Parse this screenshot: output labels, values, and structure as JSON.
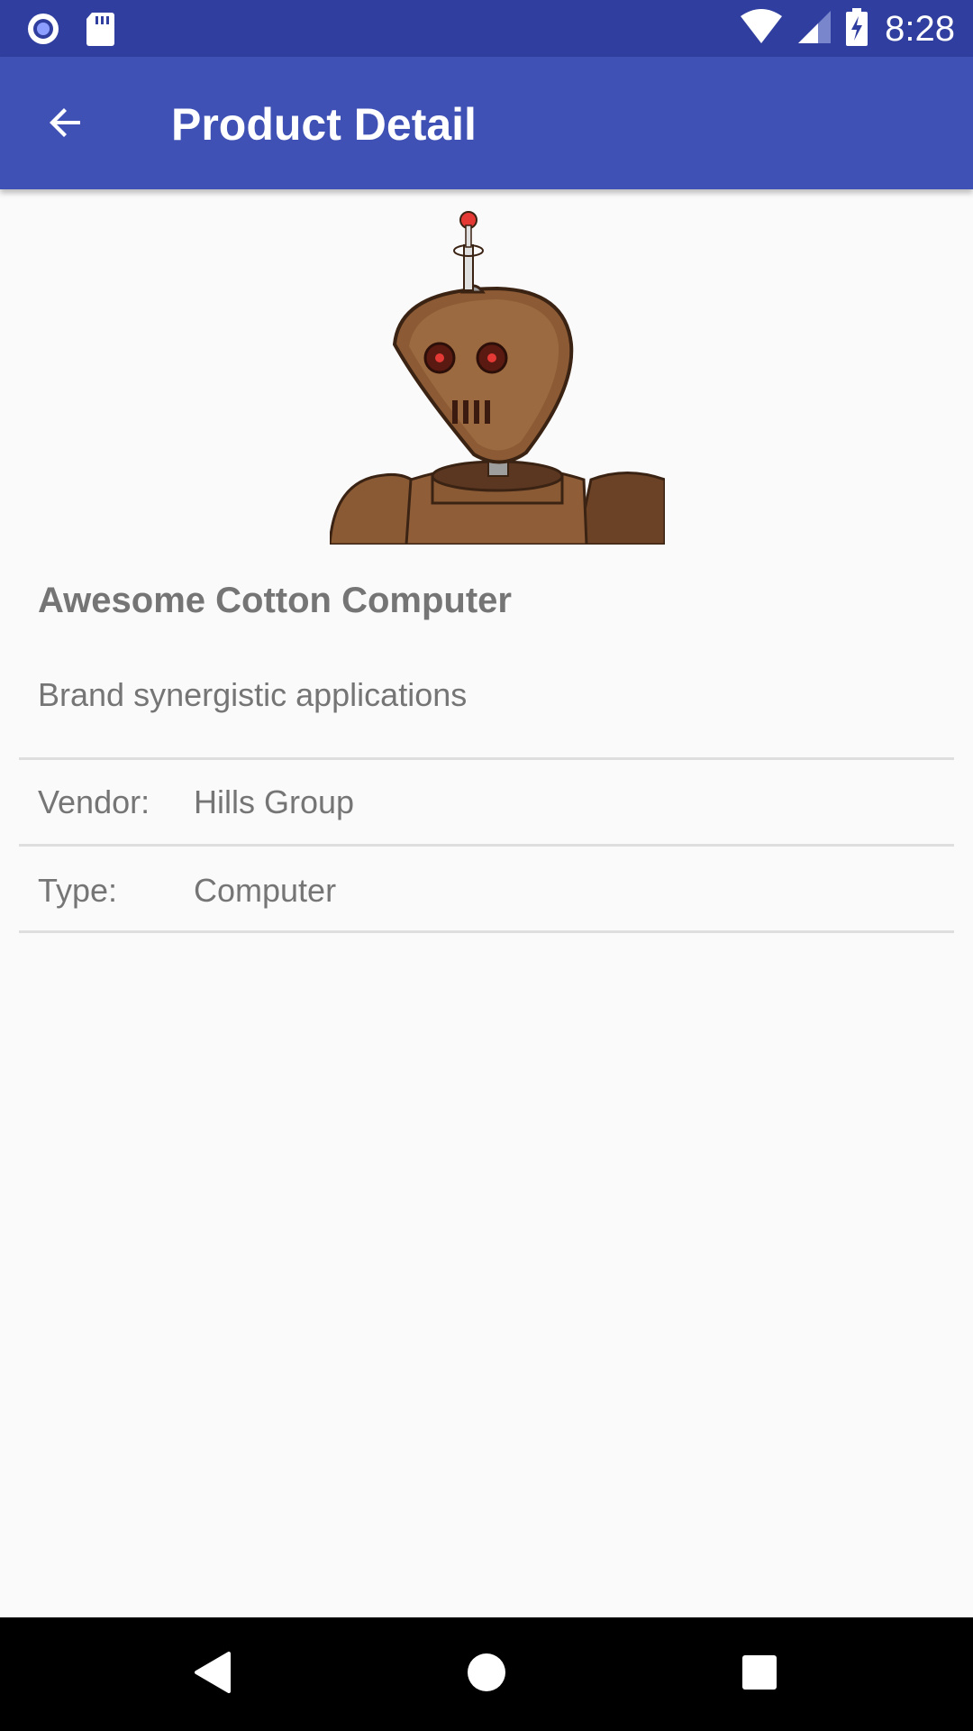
{
  "status_bar": {
    "time": "8:28",
    "icons": [
      "record-icon",
      "sd-card-icon",
      "wifi-icon",
      "signal-icon",
      "battery-charging-icon"
    ]
  },
  "app_bar": {
    "title": "Product Detail",
    "back_icon": "arrow-back-icon"
  },
  "product": {
    "image_icon": "robot-illustration",
    "name": "Awesome Cotton Computer",
    "description": "Brand synergistic applications",
    "details": [
      {
        "label": "Vendor:",
        "value": "Hills Group"
      },
      {
        "label": "Type:",
        "value": "Computer"
      }
    ]
  },
  "nav_bar": {
    "icons": [
      "back-triangle-icon",
      "home-circle-icon",
      "recents-square-icon"
    ]
  },
  "colors": {
    "status_bar": "#303f9f",
    "app_bar": "#3f51b5",
    "background": "#fafafa",
    "text_secondary": "#757575"
  }
}
